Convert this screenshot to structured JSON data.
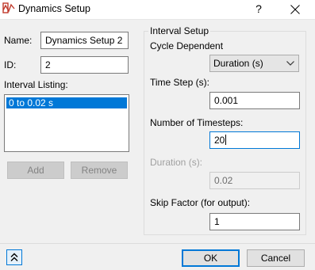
{
  "window": {
    "title": "Dynamics Setup",
    "help_label": "?",
    "icons": {
      "app": "dynamics-app-icon",
      "close": "close-icon"
    }
  },
  "left": {
    "name_label": "Name:",
    "name_value": "Dynamics Setup 2",
    "id_label": "ID:",
    "id_value": "2",
    "interval_listing_label": "Interval Listing:",
    "intervals": [
      "0 to 0.02 s"
    ],
    "add_label": "Add",
    "remove_label": "Remove"
  },
  "interval_setup": {
    "legend": "Interval Setup",
    "cycle_dependent_label": "Cycle Dependent",
    "cycle_mode_selected": "Duration (s)",
    "time_step_label": "Time Step (s):",
    "time_step_value": "0.001",
    "timesteps_label": "Number of Timesteps:",
    "timesteps_value": "20",
    "duration_label": "Duration (s):",
    "duration_value": "0.02",
    "skip_label": "Skip Factor (for output):",
    "skip_value": "1"
  },
  "footer": {
    "ok_label": "OK",
    "cancel_label": "Cancel",
    "expand_icon": "double-chevron-up-icon"
  },
  "colors": {
    "accent": "#0078d7",
    "background": "#f0f0f0",
    "selection": "#0078d7"
  }
}
